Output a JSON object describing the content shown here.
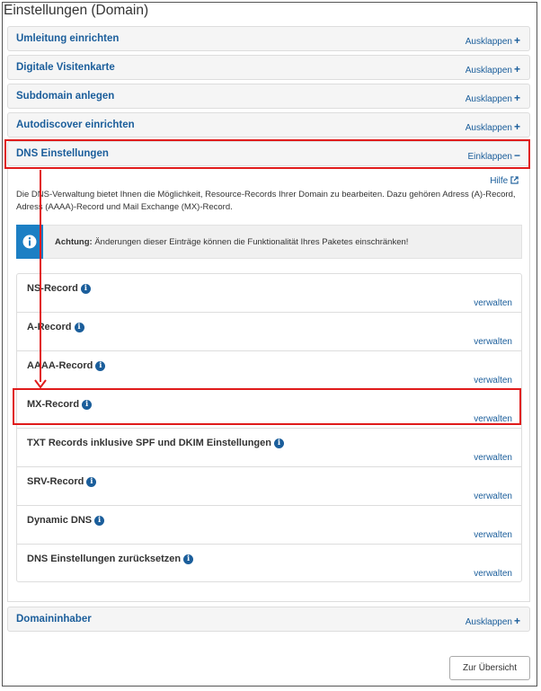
{
  "page_title": "Einstellungen (Domain)",
  "sections": [
    {
      "title": "Umleitung einrichten",
      "toggle": "Ausklappen",
      "sign": "+"
    },
    {
      "title": "Digitale Visitenkarte",
      "toggle": "Ausklappen",
      "sign": "+"
    },
    {
      "title": "Subdomain anlegen",
      "toggle": "Ausklappen",
      "sign": "+"
    },
    {
      "title": "Autodiscover einrichten",
      "toggle": "Ausklappen",
      "sign": "+"
    },
    {
      "title": "DNS Einstellungen",
      "toggle": "Einklappen",
      "sign": "−"
    },
    {
      "title": "Domaininhaber",
      "toggle": "Ausklappen",
      "sign": "+"
    }
  ],
  "dns": {
    "help_label": "Hilfe",
    "description": "Die DNS-Verwaltung bietet Ihnen die Möglichkeit, Resource-Records Ihrer Domain zu bearbeiten. Dazu gehören Adress (A)-Record, Adress (AAAA)-Record und Mail Exchange (MX)-Record.",
    "alert_strong": "Achtung:",
    "alert_text": " Änderungen dieser Einträge können die Funktionalität Ihres Paketes einschränken!",
    "records": [
      {
        "label": "NS-Record",
        "action": "verwalten"
      },
      {
        "label": "A-Record",
        "action": "verwalten"
      },
      {
        "label": "AAAA-Record",
        "action": "verwalten"
      },
      {
        "label": "MX-Record",
        "action": "verwalten"
      },
      {
        "label": "TXT Records inklusive SPF und DKIM Einstellungen",
        "action": "verwalten"
      },
      {
        "label": "SRV-Record",
        "action": "verwalten"
      },
      {
        "label": "Dynamic DNS",
        "action": "verwalten"
      },
      {
        "label": "DNS Einstellungen zurücksetzen",
        "action": "verwalten"
      }
    ]
  },
  "footer": {
    "back_button": "Zur Übersicht"
  },
  "colors": {
    "link": "#1b5e9b",
    "highlight": "#e01b1b",
    "info": "#1c7fc4"
  }
}
